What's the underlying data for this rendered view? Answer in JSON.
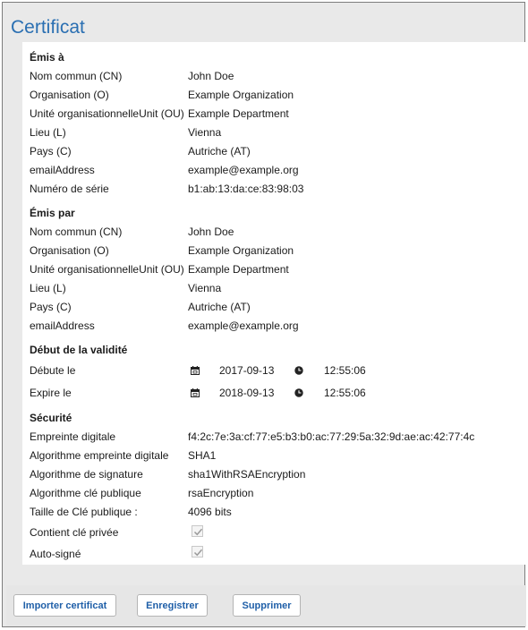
{
  "title": "Certificat",
  "issued_to": {
    "heading": "Émis à",
    "rows": [
      {
        "label": "Nom commun (CN)",
        "value": "John Doe"
      },
      {
        "label": "Organisation (O)",
        "value": "Example Organization"
      },
      {
        "label": "Unité organisationnelleUnit (OU)",
        "value": "Example Department"
      },
      {
        "label": "Lieu (L)",
        "value": "Vienna"
      },
      {
        "label": "Pays (C)",
        "value": "Autriche (AT)"
      },
      {
        "label": "emailAddress",
        "value": "example@example.org"
      },
      {
        "label": "Numéro de série",
        "value": "b1:ab:13:da:ce:83:98:03"
      }
    ]
  },
  "issued_by": {
    "heading": "Émis par",
    "rows": [
      {
        "label": "Nom commun (CN)",
        "value": "John Doe"
      },
      {
        "label": "Organisation (O)",
        "value": "Example Organization"
      },
      {
        "label": "Unité organisationnelleUnit (OU)",
        "value": "Example Department"
      },
      {
        "label": "Lieu (L)",
        "value": "Vienna"
      },
      {
        "label": "Pays (C)",
        "value": "Autriche (AT)"
      },
      {
        "label": "emailAddress",
        "value": "example@example.org"
      }
    ]
  },
  "validity": {
    "heading": "Début de la validité",
    "start": {
      "label": "Débute le",
      "date": "2017-09-13",
      "time": "12:55:06"
    },
    "end": {
      "label": "Expire le",
      "date": "2018-09-13",
      "time": "12:55:06"
    }
  },
  "security": {
    "heading": "Sécurité",
    "rows": [
      {
        "label": "Empreinte digitale",
        "value": "f4:2c:7e:3a:cf:77:e5:b3:b0:ac:77:29:5a:32:9d:ae:ac:42:77:4c"
      },
      {
        "label": "Algorithme empreinte digitale",
        "value": "SHA1"
      },
      {
        "label": "Algorithme de signature",
        "value": "sha1WithRSAEncryption"
      },
      {
        "label": "Algorithme clé publique",
        "value": "rsaEncryption"
      },
      {
        "label": "Taille de Clé publique :",
        "value": "4096 bits"
      }
    ],
    "has_private_key": {
      "label": "Contient clé privée",
      "checked": true
    },
    "self_signed": {
      "label": "Auto-signé",
      "checked": true
    }
  },
  "buttons": {
    "import": "Importer certificat",
    "save": "Enregistrer",
    "delete": "Supprimer"
  },
  "colors": {
    "title": "#2a6fb2",
    "button_text": "#1f5fa8"
  }
}
